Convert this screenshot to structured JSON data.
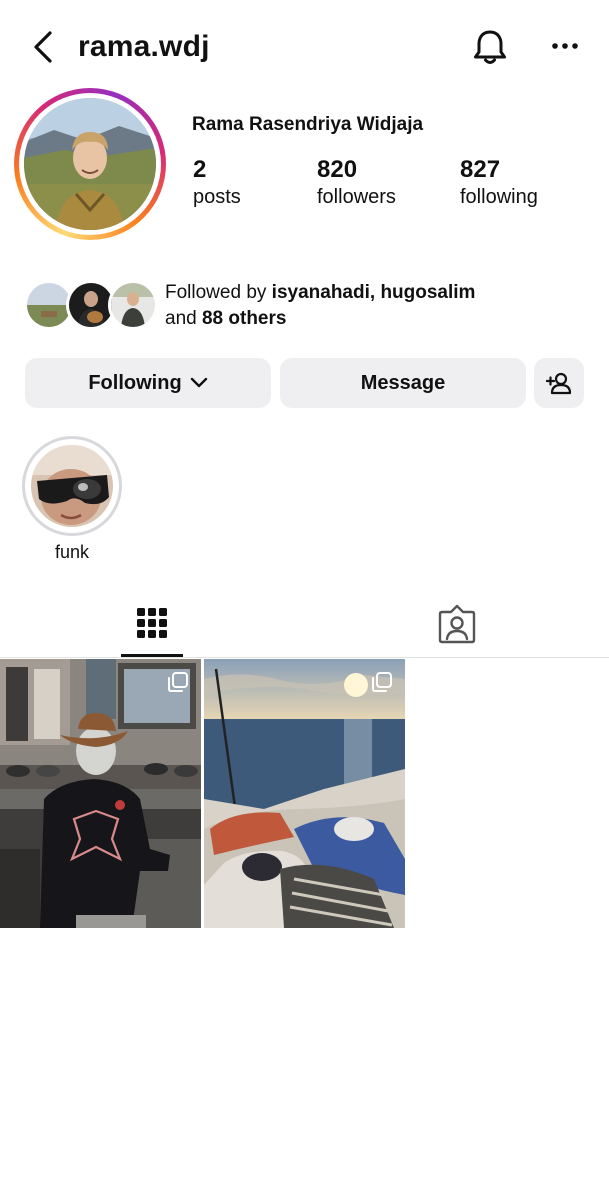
{
  "header": {
    "username": "rama.wdj",
    "back_icon": "chevron-left-icon",
    "notifications_icon": "bell-icon",
    "more_icon": "more-horizontal-icon"
  },
  "profile": {
    "full_name": "Rama Rasendriya Widjaja",
    "stats": [
      {
        "value": "2",
        "label": "posts"
      },
      {
        "value": "820",
        "label": "followers"
      },
      {
        "value": "827",
        "label": "following"
      }
    ],
    "followed_by": {
      "prefix": "Followed by ",
      "names": "isyanahadi, hugosalim",
      "and": "and ",
      "others": "88 others"
    }
  },
  "actions": {
    "following_label": "Following",
    "message_label": "Message",
    "add_user_icon": "add-person-icon"
  },
  "highlights": [
    {
      "label": "funk"
    }
  ],
  "tabs": {
    "grid_icon": "grid-icon",
    "tagged_icon": "tagged-person-icon",
    "active": "grid"
  },
  "colors": {
    "button_bg": "#efeff1",
    "story_ring": [
      "#feda75",
      "#fa7e1e",
      "#d62976",
      "#962fbf"
    ]
  }
}
